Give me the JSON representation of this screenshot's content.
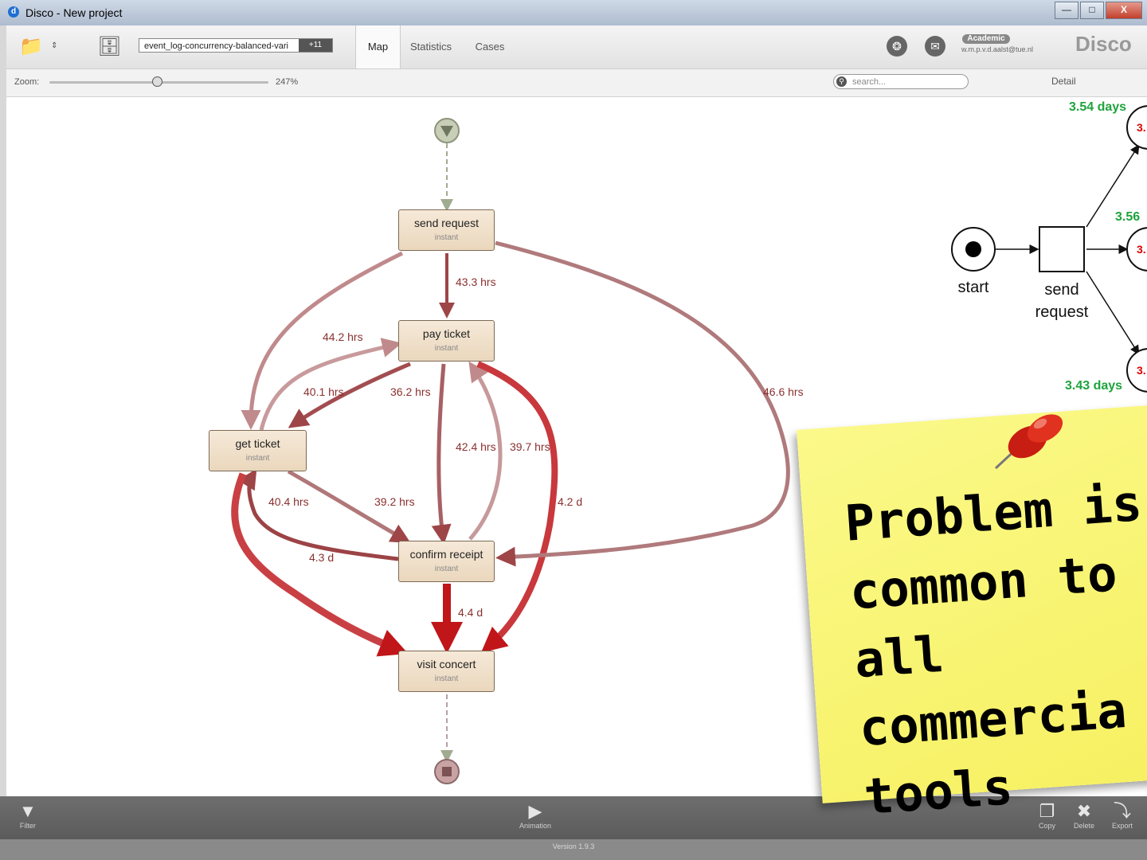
{
  "window": {
    "title": "Disco - New project",
    "app_icon": "disco-app-icon"
  },
  "toolbar": {
    "log_name": "event_log-concurrency-balanced-vari",
    "log_badge": "+11",
    "tabs": [
      {
        "label": "Map",
        "active": true
      },
      {
        "label": "Statistics",
        "active": false
      },
      {
        "label": "Cases",
        "active": false
      }
    ],
    "license": "Academic",
    "user": "w.m.p.v.d.aalst@tue.nl",
    "brand": "Disco"
  },
  "zoombar": {
    "label": "Zoom:",
    "value": "247%",
    "level_fraction": 0.49,
    "search_placeholder": "search...",
    "detail": "Detail"
  },
  "map": {
    "nodes": [
      {
        "name": "send request",
        "sub": "instant"
      },
      {
        "name": "pay ticket",
        "sub": "instant"
      },
      {
        "name": "get ticket",
        "sub": "instant"
      },
      {
        "name": "confirm receipt",
        "sub": "instant"
      },
      {
        "name": "visit concert",
        "sub": "instant"
      }
    ],
    "edge_labels": [
      "43.3 hrs",
      "44.2 hrs",
      "40.1 hrs",
      "36.2 hrs",
      "46.6 hrs",
      "42.4 hrs",
      "39.7 hrs",
      "40.4 hrs",
      "39.2 hrs",
      "4.2 d",
      "4.3 d",
      "4.4 d"
    ]
  },
  "petri": {
    "start": "start",
    "send": "send\nrequest",
    "green": [
      "3.54 days",
      "3.56",
      "3.43 days"
    ],
    "red": [
      "3.",
      "3.",
      "3."
    ]
  },
  "sticky": {
    "text": "Problem is\ncommon to\nall\ncommercia\ntools"
  },
  "bottom": {
    "filter": "Filter",
    "animation": "Animation",
    "copy": "Copy",
    "delete": "Delete",
    "export": "Export",
    "version": "Version 1.9.3"
  },
  "colors": {
    "edge_dark": "#9e4548",
    "edge_light": "#cfa0a0",
    "edge_heavy": "#c0161a",
    "sticky": "#f8f27a"
  }
}
